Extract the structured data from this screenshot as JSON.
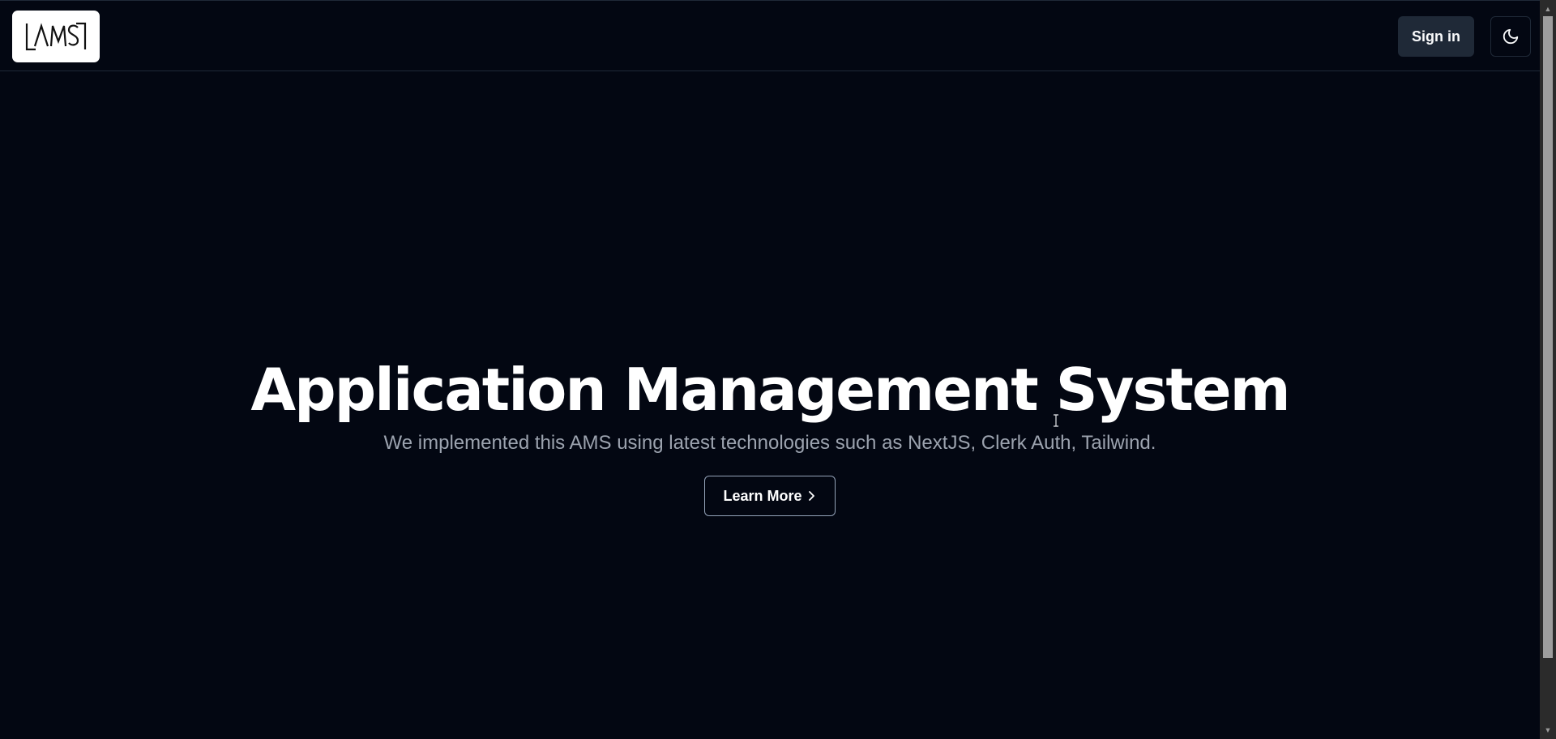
{
  "header": {
    "logo_text": "AMS",
    "signin_label": "Sign in",
    "theme_icon": "moon-icon"
  },
  "hero": {
    "title": "Application Management System",
    "subtitle": "We implemented this AMS using latest technologies such as NextJS, Clerk Auth, Tailwind.",
    "cta_label": "Learn More",
    "cta_icon": "chevron-right-icon"
  },
  "colors": {
    "background": "#030712",
    "signin_bg": "#1f2937",
    "subtitle": "#9ca3af",
    "cta_border": "#94a3b8"
  }
}
